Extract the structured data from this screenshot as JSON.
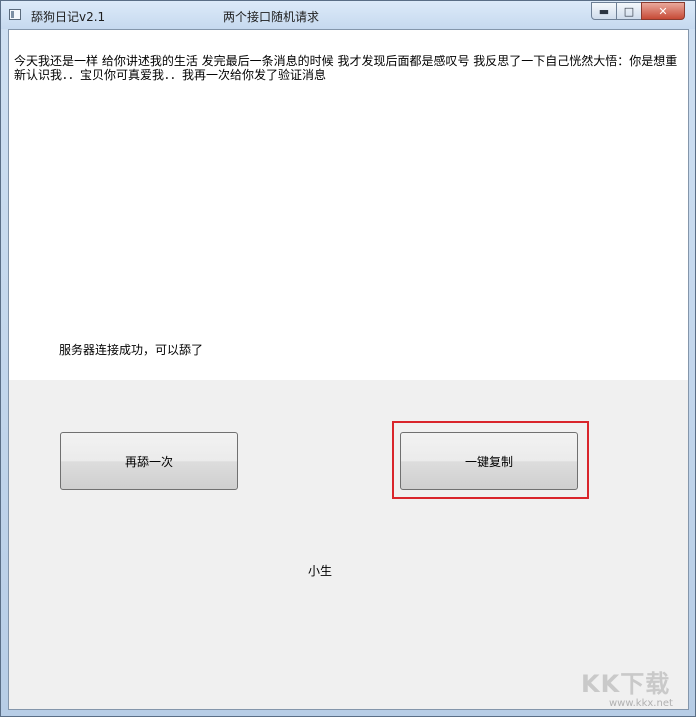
{
  "window": {
    "title": "舔狗日记v2.1",
    "subtitle": "两个接口随机请求",
    "minimize_glyph": "▬",
    "maximize_glyph": "□",
    "close_glyph": "✕"
  },
  "content": {
    "message": "今天我还是一样 给你讲述我的生活 发完最后一条消息的时候 我才发现后面都是感叹号 我反思了一下自己恍然大悟：你是想重新认识我．．宝贝你可真爱我．．我再一次给你发了验证消息",
    "status": "服务器连接成功，可以舔了"
  },
  "buttons": {
    "again_label": "再舔一次",
    "copy_label": "一键复制"
  },
  "footer": {
    "author": "小生"
  },
  "watermark": {
    "logo_text": "KK下载",
    "url": "www.kkx.net"
  },
  "colors": {
    "highlight": "#d9252b",
    "client_bg": "#f0f0f0"
  }
}
